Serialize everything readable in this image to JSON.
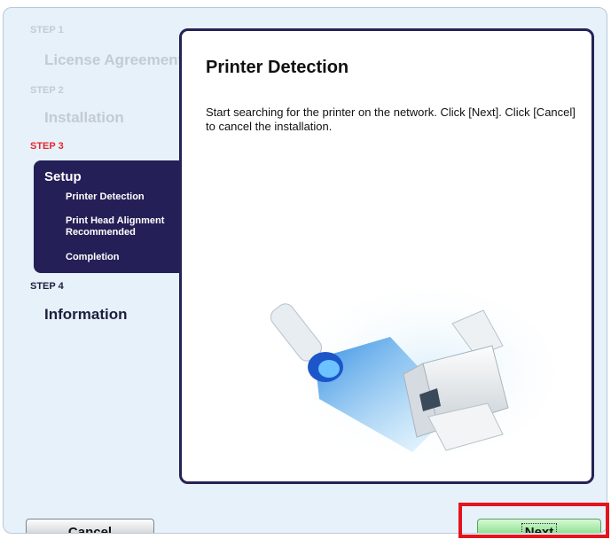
{
  "sidebar": {
    "step1": {
      "label": "STEP 1",
      "title": "License Agreement"
    },
    "step2": {
      "label": "STEP 2",
      "title": "Installation"
    },
    "step3": {
      "label": "STEP 3",
      "title": "Setup",
      "items": [
        "Printer Detection",
        "Print Head Alignment Recommended",
        "Completion"
      ]
    },
    "step4": {
      "label": "STEP 4",
      "title": "Information"
    }
  },
  "content": {
    "title": "Printer Detection",
    "text": "Start searching for the printer on the network. Click [Next]. Click [Cancel] to cancel the installation."
  },
  "buttons": {
    "cancel": "Cancel",
    "next": "Next"
  },
  "colors": {
    "active_step": "#241f56",
    "current_step_label": "#e8272c",
    "next_button": "#8be28d",
    "highlight": "#e4141c"
  },
  "illustration": {
    "icons": [
      "flashlight-icon",
      "printer-icon"
    ]
  }
}
